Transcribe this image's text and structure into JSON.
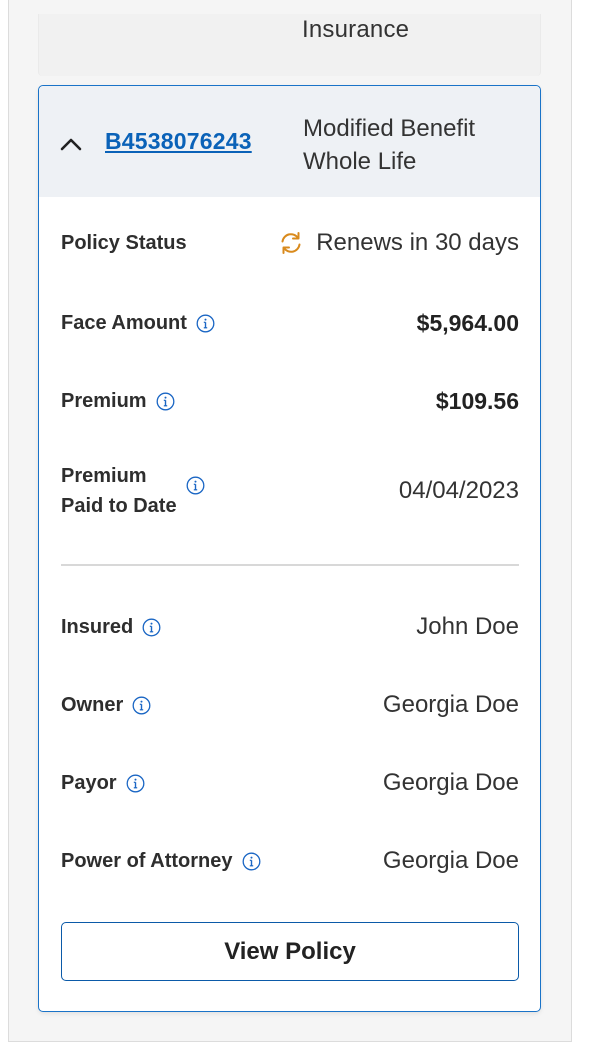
{
  "previous_card": {
    "policy_type_tail": "Insurance"
  },
  "policy": {
    "number": "B4538076243",
    "type": "Modified Benefit Whole Life"
  },
  "details": {
    "policy_status": {
      "label": "Policy Status",
      "value": "Renews in 30 days",
      "icon": "renew-icon",
      "icon_color": "#d98a1c"
    },
    "face_amount": {
      "label": "Face Amount",
      "value": "$5,964.00"
    },
    "premium": {
      "label": "Premium",
      "value": "$109.56"
    },
    "premium_paid_to_date": {
      "label_line1": "Premium",
      "label_line2": "Paid to Date",
      "value": "04/04/2023"
    },
    "insured": {
      "label": "Insured",
      "value": "John Doe"
    },
    "owner": {
      "label": "Owner",
      "value": "Georgia Doe"
    },
    "payor": {
      "label": "Payor",
      "value": "Georgia Doe"
    },
    "power_of_attorney": {
      "label": "Power of Attorney",
      "value": "Georgia Doe"
    }
  },
  "actions": {
    "view_policy": "View Policy"
  },
  "colors": {
    "accent": "#0a62b8",
    "card_border": "#1a73c8",
    "header_bg": "#eef1f5"
  }
}
